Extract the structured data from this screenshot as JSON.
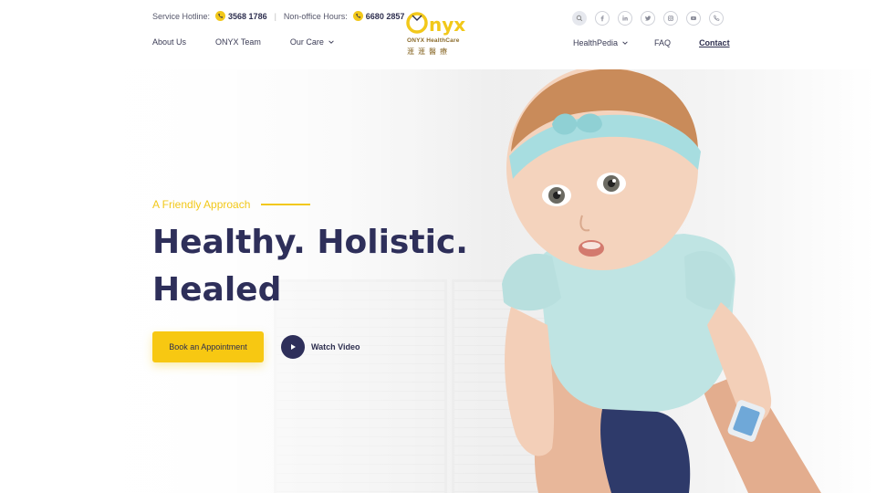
{
  "header": {
    "hotline_label": "Service Hotline:",
    "hotline_number": "3568 1786",
    "separator": "|",
    "nonoffice_label": "Non-office Hours:",
    "nonoffice_number": "6680 2857",
    "nav_left": [
      "About Us",
      "ONYX Team",
      "Our Care"
    ],
    "nav_right": {
      "healthpedia": "HealthPedia",
      "faq": "FAQ",
      "contact": "Contact"
    },
    "logo": {
      "word": "ONYX",
      "sub": "ONYX HealthCare",
      "chinese": "滙滙醫療"
    },
    "social_icons": [
      "search-icon",
      "facebook-icon",
      "linkedin-icon",
      "twitter-icon",
      "instagram-icon",
      "youtube-icon",
      "phone-icon"
    ]
  },
  "hero": {
    "tagline": "A Friendly Approach",
    "headline_line1": "Healthy. Holistic.",
    "headline_line2": "Healed",
    "book_button": "Book an Appointment",
    "watch_video": "Watch Video"
  },
  "colors": {
    "accent": "#f2c81a",
    "navy": "#2e2f5a"
  }
}
